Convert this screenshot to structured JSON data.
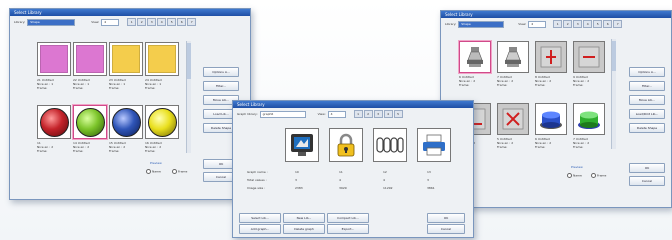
{
  "colors": {
    "title_blue": "#2a5cb5",
    "pink": "#dc77d1",
    "yellow": "#f4cd4c",
    "ball_red": "#c4232a",
    "ball_green": "#7cc42a",
    "ball_blue": "#2f55b8",
    "ball_yellow": "#e9df1d"
  },
  "win_left": {
    "title": "Select Library",
    "library_label": "Library:",
    "library_value": "Shape",
    "view_label": "View:",
    "view_value": "4",
    "page_buttons": [
      "1",
      "2",
      "3",
      "4",
      "5",
      "6",
      "7"
    ],
    "cells": [
      {
        "name": "21 Untitled",
        "line2": "Nice en : 1",
        "line3": "Frame:",
        "icon": "pink-square-icon",
        "color": "#dc77d1",
        "kind": "swatch"
      },
      {
        "name": "22 Untitled",
        "line2": "Nice en : 1",
        "line3": "Frame:",
        "icon": "pink-square-icon",
        "color": "#dc77d1",
        "kind": "swatch"
      },
      {
        "name": "23 Untitled",
        "line2": "Nice en : 1",
        "line3": "Frame:",
        "icon": "yellow-square-icon",
        "color": "#f4cd4c",
        "kind": "swatch"
      },
      {
        "name": "24 Untitled",
        "line2": "Nice en : 1",
        "line3": "Frame:",
        "icon": "yellow-square-icon",
        "color": "#f4cd4c",
        "kind": "swatch"
      },
      {
        "name": "11",
        "line2": "Nice en : 2",
        "line3": "Frame:",
        "icon": "red-ball-icon",
        "color": "#c4232a",
        "kind": "ball"
      },
      {
        "name": "14 Untitled",
        "line2": "Nice en : 2",
        "line3": "Frame:",
        "icon": "green-ball-icon",
        "color": "#7cc42a",
        "kind": "ball"
      },
      {
        "name": "15 Untitled",
        "line2": "Nice en : 2",
        "line3": "Frame:",
        "icon": "blue-ball-icon",
        "color": "#2f55b8",
        "kind": "ball"
      },
      {
        "name": "16 Untitled",
        "line2": "Nice en : 2",
        "line3": "Frame:",
        "icon": "yellow-ball-icon",
        "color": "#e9df1d",
        "kind": "ball"
      }
    ],
    "side_buttons": [
      "Options A...",
      "Filter...",
      "Move Lib...",
      "Load Lib...",
      "Delete Shape"
    ],
    "preview_label": "Preview",
    "radio_a": "Name",
    "radio_b": "Frame",
    "ok": "OK",
    "cancel": "Cancel"
  },
  "win_center": {
    "title": "Select Library",
    "library_label": "Graph library:",
    "library_value": "graph6",
    "view_label": "View:",
    "view_value": "4",
    "page_buttons": [
      "1",
      "2",
      "3",
      "4",
      "5"
    ],
    "tiles": [
      {
        "icon": "monitor-icon"
      },
      {
        "icon": "padlock-icon"
      },
      {
        "icon": "chain-icon"
      },
      {
        "icon": "printer-icon"
      }
    ],
    "row_labels": [
      "Graph name :",
      "Total values :",
      "Image size :"
    ],
    "row_values": [
      [
        "10",
        "11",
        "12",
        "13"
      ],
      [
        "3",
        "4",
        "4",
        "3"
      ],
      [
        "2383",
        "3929",
        "11292",
        "3861"
      ]
    ],
    "bottom_buttons": [
      "Select Lib...",
      "New Lib...",
      "Compact Lib...",
      "Add graph...",
      "Delete graph",
      "Export..."
    ],
    "ok": "OK",
    "cancel": "Cancel"
  },
  "win_right": {
    "title": "Select Library",
    "library_label": "Library:",
    "library_value": "Shape",
    "view_label": "View:",
    "view_value": "4",
    "page_buttons": [
      "1",
      "2",
      "3",
      "4",
      "5",
      "6",
      "7"
    ],
    "cells": [
      {
        "name": "6 Untitled",
        "line2": "Nice en : 2",
        "line3": "Frame:",
        "icon": "bell-lamp-icon"
      },
      {
        "name": "7 Untitled",
        "line2": "Nice en : 2",
        "line3": "Frame:",
        "icon": "bell-lamp-icon"
      },
      {
        "name": "8 Untitled",
        "line2": "Nice en : 2",
        "line3": "Frame:",
        "icon": "red-plus-tile-icon"
      },
      {
        "name": "9 Untitled",
        "line2": "Nice en : 2",
        "line3": "Frame:",
        "icon": "red-minus-tile-icon"
      },
      {
        "name": "4 Untitled",
        "line2": "Nice en : 2",
        "line3": "Frame:",
        "icon": "red-underline-tile-icon"
      },
      {
        "name": "5 Untitled",
        "line2": "Nice en : 2",
        "line3": "Frame:",
        "icon": "red-cross-tile-icon"
      },
      {
        "name": "6 Untitled",
        "line2": "Nice en : 2",
        "line3": "Frame:",
        "icon": "blue-cylinder-button-icon"
      },
      {
        "name": "7 Untitled",
        "line2": "Nice en : 2",
        "line3": "Frame:",
        "icon": "green-cylinder-button-icon"
      }
    ],
    "side_buttons": [
      "Options A...",
      "Filter...",
      "Move Lib...",
      "Load/Rmt Lib...",
      "Delete Shape"
    ],
    "preview_label": "Preview",
    "radio_a": "Name",
    "radio_b": "Frame",
    "ok": "OK",
    "cancel": "Cancel"
  }
}
